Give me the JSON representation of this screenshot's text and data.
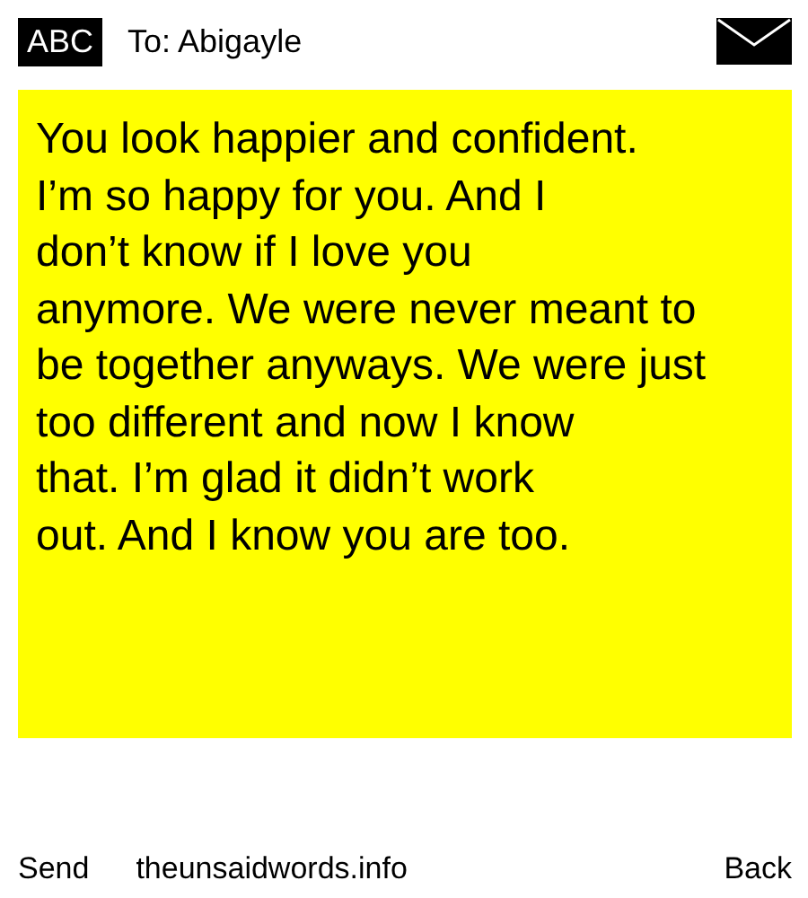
{
  "header": {
    "badge": "ABC",
    "recipient": "To: Abigayle"
  },
  "message": {
    "text": "You look happier and confident.\nI’m so happy for you. And I\ndon’t know if I love you\nanymore. We were never meant to\nbe together anyways. We were just\ntoo different and now I know\nthat. I’m glad it didn’t work\nout. And I know you are too."
  },
  "footer": {
    "send": "Send",
    "site": "theunsaidwords.info",
    "back": "Back"
  }
}
